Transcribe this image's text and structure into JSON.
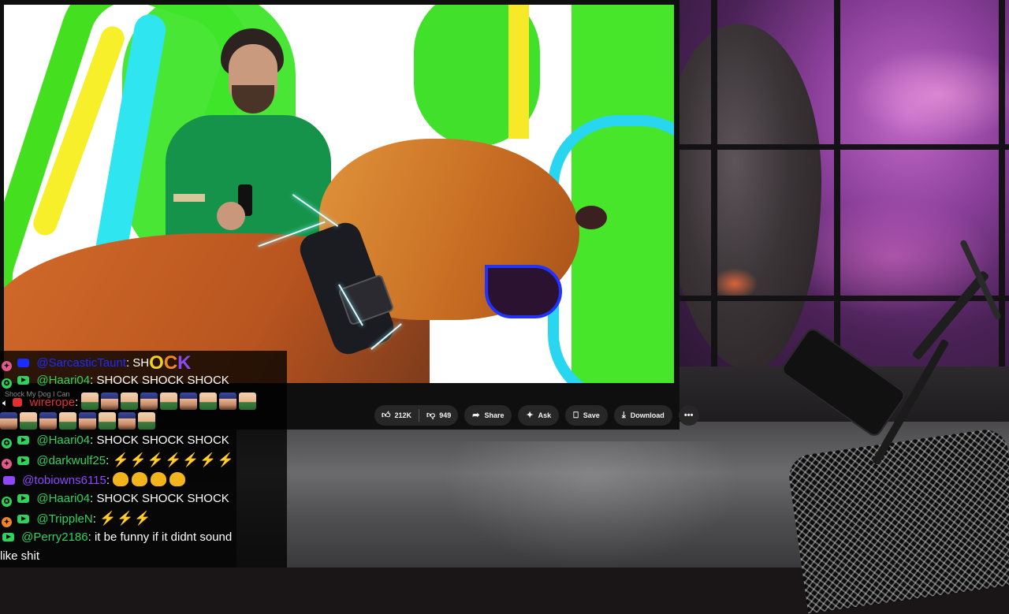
{
  "video": {
    "controls": {
      "like_count": "212K",
      "dislike_count": "949",
      "share_label": "Share",
      "ask_label": "Ask",
      "save_label": "Save",
      "download_label": "Download"
    },
    "faint_title": "Shock My Dog I Can"
  },
  "chat": {
    "messages": [
      {
        "user": "@SarcasticTaunt",
        "text": "SH",
        "emote_text": [
          "O",
          "C",
          "K"
        ],
        "user_color": "#1b2cff",
        "platform": "blue"
      },
      {
        "user": "@Haari04",
        "text": "SHOCK SHOCK SHOCK",
        "user_color": "#2fd25d",
        "platform": "youtube"
      },
      {
        "user": "wirerope",
        "text": "",
        "user_color": "#e03030",
        "platform": "red"
      },
      {
        "user": "@Haari04",
        "text": "SHOCK SHOCK SHOCK",
        "user_color": "#2fd25d",
        "platform": "youtube"
      },
      {
        "user": "@darkwulf25",
        "text": "",
        "user_color": "#2fd25d",
        "platform": "youtube"
      },
      {
        "user": "@tobiowns6115",
        "text": "",
        "user_color": "#9146ff",
        "platform": "twitch"
      },
      {
        "user": "@Haari04",
        "text": "SHOCK SHOCK SHOCK",
        "user_color": "#2fd25d",
        "platform": "youtube"
      },
      {
        "user": "@TrippleN",
        "text": "",
        "user_color": "#2fd25d",
        "platform": "youtube"
      },
      {
        "user": "@Perry2186",
        "text": "it be funny if it didnt sound",
        "continuation": "like shit",
        "user_color": "#2fd25d",
        "platform": "youtube"
      }
    ]
  },
  "colors": {
    "youtube_green": "#2fd25d",
    "twitch_purple": "#9146ff",
    "bolt_yellow": "#f7c21a"
  }
}
